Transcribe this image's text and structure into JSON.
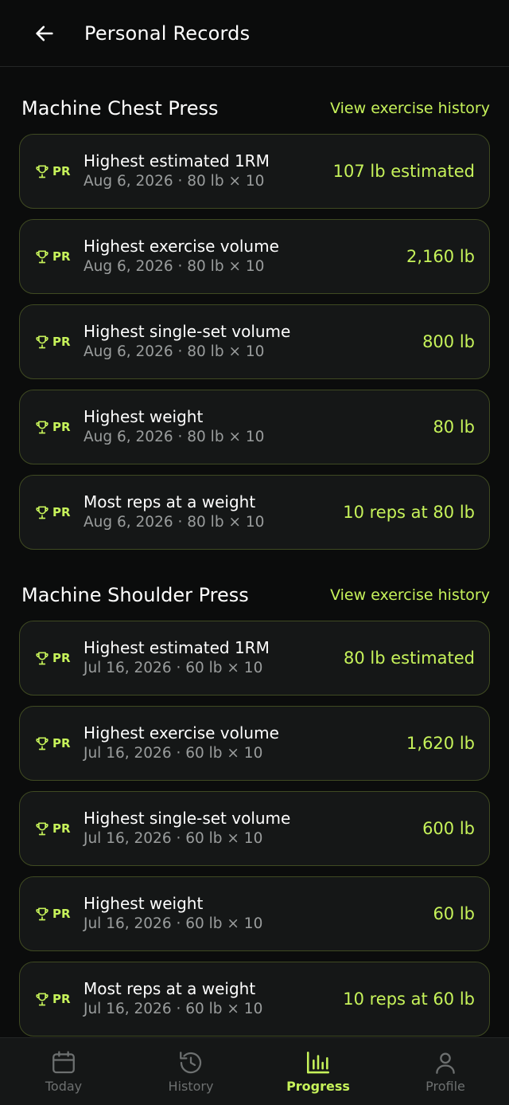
{
  "header": {
    "title": "Personal Records"
  },
  "sections": [
    {
      "title": "Machine Chest Press",
      "link": "View exercise history",
      "records": [
        {
          "badge": "PR",
          "label": "Highest estimated 1RM",
          "sub": "Aug 6, 2026 · 80 lb × 10",
          "value": "107 lb estimated"
        },
        {
          "badge": "PR",
          "label": "Highest exercise volume",
          "sub": "Aug 6, 2026 · 80 lb × 10",
          "value": "2,160 lb"
        },
        {
          "badge": "PR",
          "label": "Highest single-set volume",
          "sub": "Aug 6, 2026 · 80 lb × 10",
          "value": "800 lb"
        },
        {
          "badge": "PR",
          "label": "Highest weight",
          "sub": "Aug 6, 2026 · 80 lb × 10",
          "value": "80 lb"
        },
        {
          "badge": "PR",
          "label": "Most reps at a weight",
          "sub": "Aug 6, 2026 · 80 lb × 10",
          "value": "10 reps at 80 lb"
        }
      ]
    },
    {
      "title": "Machine Shoulder Press",
      "link": "View exercise history",
      "records": [
        {
          "badge": "PR",
          "label": "Highest estimated 1RM",
          "sub": "Jul 16, 2026 · 60 lb × 10",
          "value": "80 lb estimated"
        },
        {
          "badge": "PR",
          "label": "Highest exercise volume",
          "sub": "Jul 16, 2026 · 60 lb × 10",
          "value": "1,620 lb"
        },
        {
          "badge": "PR",
          "label": "Highest single-set volume",
          "sub": "Jul 16, 2026 · 60 lb × 10",
          "value": "600 lb"
        },
        {
          "badge": "PR",
          "label": "Highest weight",
          "sub": "Jul 16, 2026 · 60 lb × 10",
          "value": "60 lb"
        },
        {
          "badge": "PR",
          "label": "Most reps at a weight",
          "sub": "Jul 16, 2026 · 60 lb × 10",
          "value": "10 reps at 60 lb"
        }
      ]
    }
  ],
  "nav": {
    "items": [
      {
        "label": "Today",
        "icon": "calendar-icon"
      },
      {
        "label": "History",
        "icon": "history-icon"
      },
      {
        "label": "Progress",
        "icon": "bar-chart-icon",
        "active": true
      },
      {
        "label": "Profile",
        "icon": "user-icon"
      }
    ]
  },
  "colors": {
    "accent": "#c6f25a",
    "background": "#0b0c0c",
    "card": "#151717",
    "card_border": "#3f4a22",
    "muted": "#9a9d9d"
  }
}
